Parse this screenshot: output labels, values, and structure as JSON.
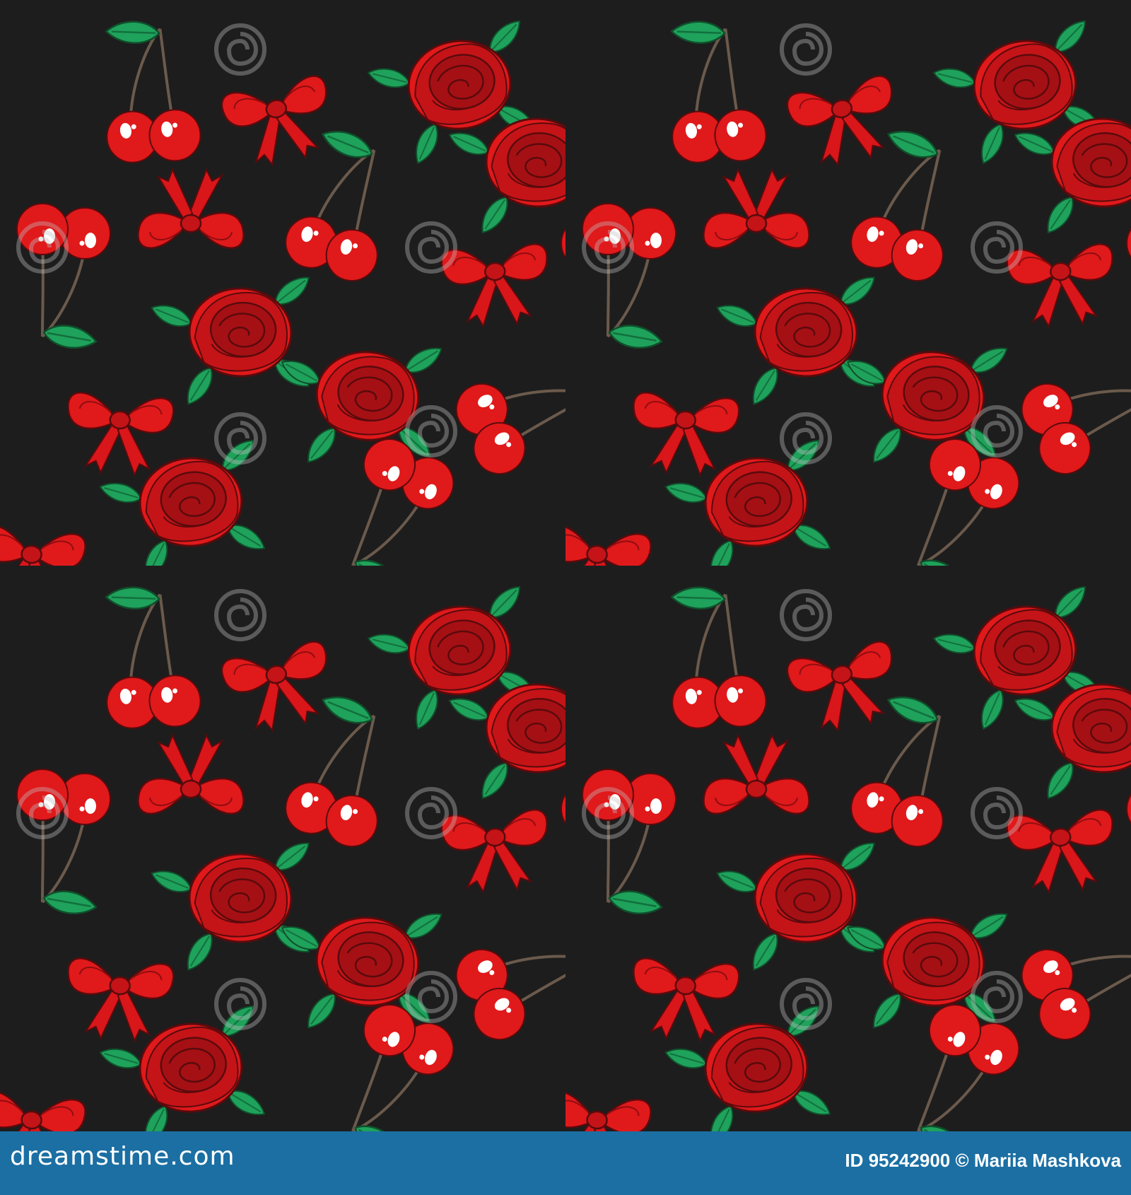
{
  "image": {
    "subject": "seamless pattern",
    "motifs": [
      "rose-icon",
      "cherry-icon",
      "bow-icon",
      "leaf-icon"
    ],
    "colors": {
      "background": "#1d1d1d",
      "red": "#e0191b",
      "dark_red": "#a51014",
      "highlight": "#ffffff",
      "leaf": "#1fa25b",
      "leaf_dark": "#12703d",
      "stem": "#6b5a4c"
    }
  },
  "watermark": {
    "text": "dreamstime",
    "icon": "spiral-icon"
  },
  "footer": {
    "brand": "dreamstime.com",
    "id_label": "ID 95242900",
    "separator": "©",
    "author": "Mariia Mashkova",
    "background": "#1b6fa3"
  }
}
